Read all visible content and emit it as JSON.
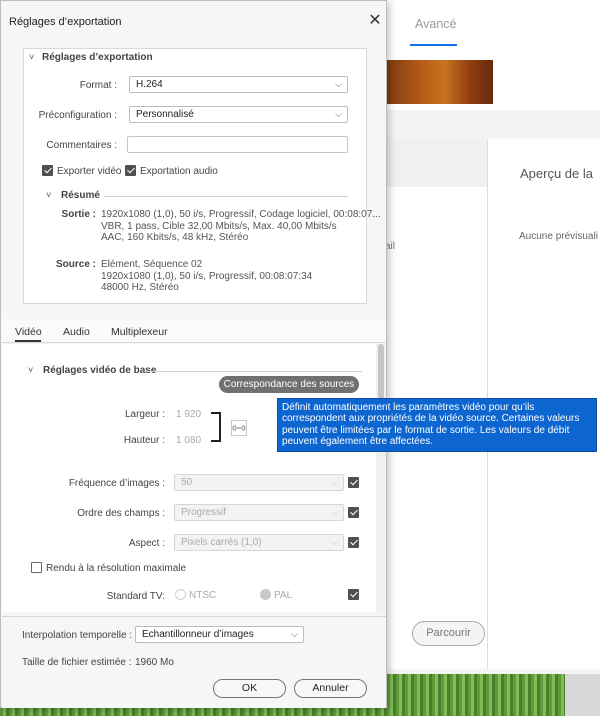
{
  "background": {
    "tab_avance": "Avancé",
    "preview_title": "Aperçu de la",
    "no_preview": "Aucune prévisuali",
    "fragment": "ail",
    "browse_button": "Parcourir"
  },
  "dialog": {
    "title": "Réglages d’exportation",
    "export_section": {
      "header": "Réglages d’exportation",
      "format_label": "Format :",
      "format_value": "H.264",
      "preset_label": "Préconfiguration :",
      "preset_value": "Personnalisé",
      "comments_label": "Commentaires :",
      "comments_value": "",
      "export_video_label": "Exporter vidéo",
      "export_audio_label": "Exportation audio",
      "export_video_checked": true,
      "export_audio_checked": true
    },
    "summary": {
      "header": "Résumé",
      "output_label": "Sortie :",
      "output_lines": [
        "1920x1080 (1,0), 50 i/s, Progressif, Codage logiciel, 00:08:07...",
        "VBR, 1 pass, Cible 32,00  Mbits/s, Max. 40,00  Mbits/s",
        "AAC, 160  Kbits/s, 48  kHz, Stéréo"
      ],
      "source_label": "Source :",
      "source_lines": [
        "Elément, Séquence 02",
        "1920x1080 (1,0), 50 i/s, Progressif, 00:08:07:34",
        "48000 Hz, Stéréo"
      ]
    },
    "tabs": [
      {
        "label": "Vidéo",
        "active": true
      },
      {
        "label": "Audio",
        "active": false
      },
      {
        "label": "Multiplexeur",
        "active": false
      }
    ],
    "video_settings": {
      "header": "Réglages vidéo de base",
      "match_source_button": "Correspondance des sources",
      "tooltip": "Définit automatiquement les paramètres vidéo pour qu’ils correspondent aux propriétés de la vidéo source. Certaines valeurs peuvent être limitées par le format de sortie. Les valeurs de débit peuvent également être affectées.",
      "width_label": "Largeur :",
      "width_value": "1 920",
      "height_label": "Hauteur :",
      "height_value": "1 080",
      "frame_rate_label": "Fréquence d’images :",
      "frame_rate_value": "50",
      "field_order_label": "Ordre des champs :",
      "field_order_value": "Progressif",
      "aspect_label": "Aspect :",
      "aspect_value": "Pixels carrés (1,0)",
      "max_render_label": "Rendu à la résolution maximale",
      "tv_standard_label": "Standard TV:",
      "ntsc_label": "NTSC",
      "pal_label": "PAL"
    },
    "time_interpolation_label": "Interpolation temporelle :",
    "time_interpolation_value": "Echantillonneur d’images",
    "file_size_label": "Taille de fichier estimée :",
    "file_size_value": "1960 Mo",
    "ok_button": "OK",
    "cancel_button": "Annuler"
  },
  "colors": {
    "accent_blue": "#1473e6",
    "tooltip_blue": "#0d66d0",
    "match_button_gray": "#707070",
    "checkbox_fill": "#505050"
  }
}
